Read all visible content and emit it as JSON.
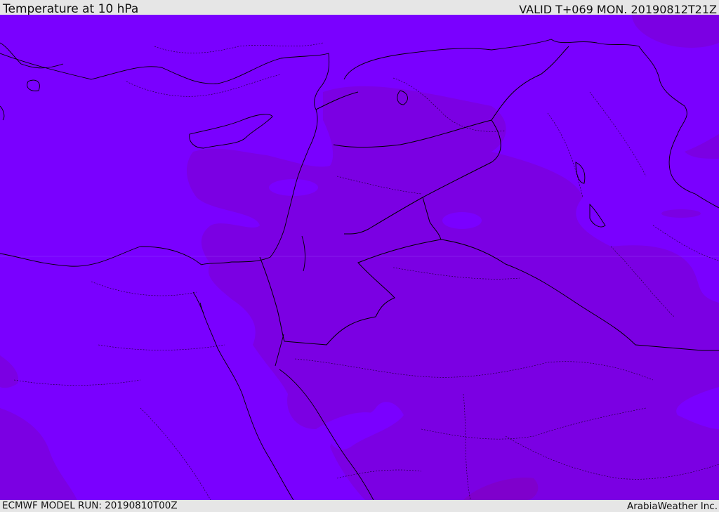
{
  "header": {
    "title": "Temperature at 10 hPa",
    "valid": "VALID T+069 MON. 20190812T21Z"
  },
  "footer": {
    "model_run": "ECMWF MODEL RUN: 20190810T00Z",
    "brand": "ArabiaWeather Inc."
  },
  "map": {
    "field_colors": {
      "light": "#7a00ff",
      "dark": "#7b00e3",
      "darkest": "#7f00cc"
    },
    "border_color": "#000000"
  }
}
